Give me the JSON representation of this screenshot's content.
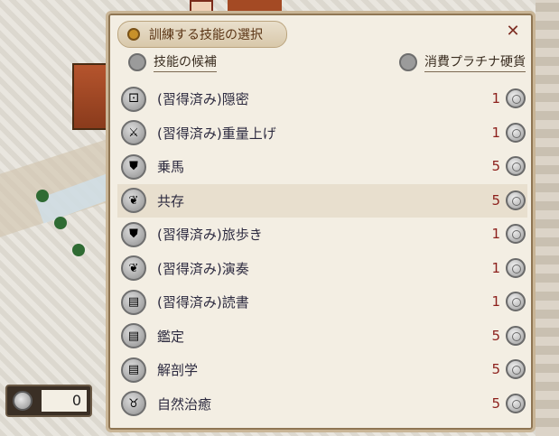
{
  "dialog": {
    "title": "訓練する技能の選択",
    "close_label": "✕",
    "header_left": "技能の候補",
    "header_right": "消費プラチナ硬貨"
  },
  "skills": [
    {
      "name": "(習得済み)隠密",
      "cost": "1",
      "icon": "stealth-icon"
    },
    {
      "name": "(習得済み)重量上げ",
      "cost": "1",
      "icon": "crossed-swords-icon"
    },
    {
      "name": "乗馬",
      "cost": "5",
      "icon": "shield-icon"
    },
    {
      "name": "共存",
      "cost": "5",
      "icon": "ribbon-icon"
    },
    {
      "name": "(習得済み)旅歩き",
      "cost": "1",
      "icon": "shield-icon"
    },
    {
      "name": "(習得済み)演奏",
      "cost": "1",
      "icon": "ribbon-icon"
    },
    {
      "name": "(習得済み)読書",
      "cost": "1",
      "icon": "book-icon"
    },
    {
      "name": "鑑定",
      "cost": "5",
      "icon": "book-icon"
    },
    {
      "name": "解剖学",
      "cost": "5",
      "icon": "book-icon"
    },
    {
      "name": "自然治癒",
      "cost": "5",
      "icon": "cow-icon"
    }
  ],
  "platinum_counter": {
    "value": "0"
  },
  "colors": {
    "accent": "#8c1f1b",
    "panel": "#f3eee3",
    "border": "#c9b596"
  }
}
